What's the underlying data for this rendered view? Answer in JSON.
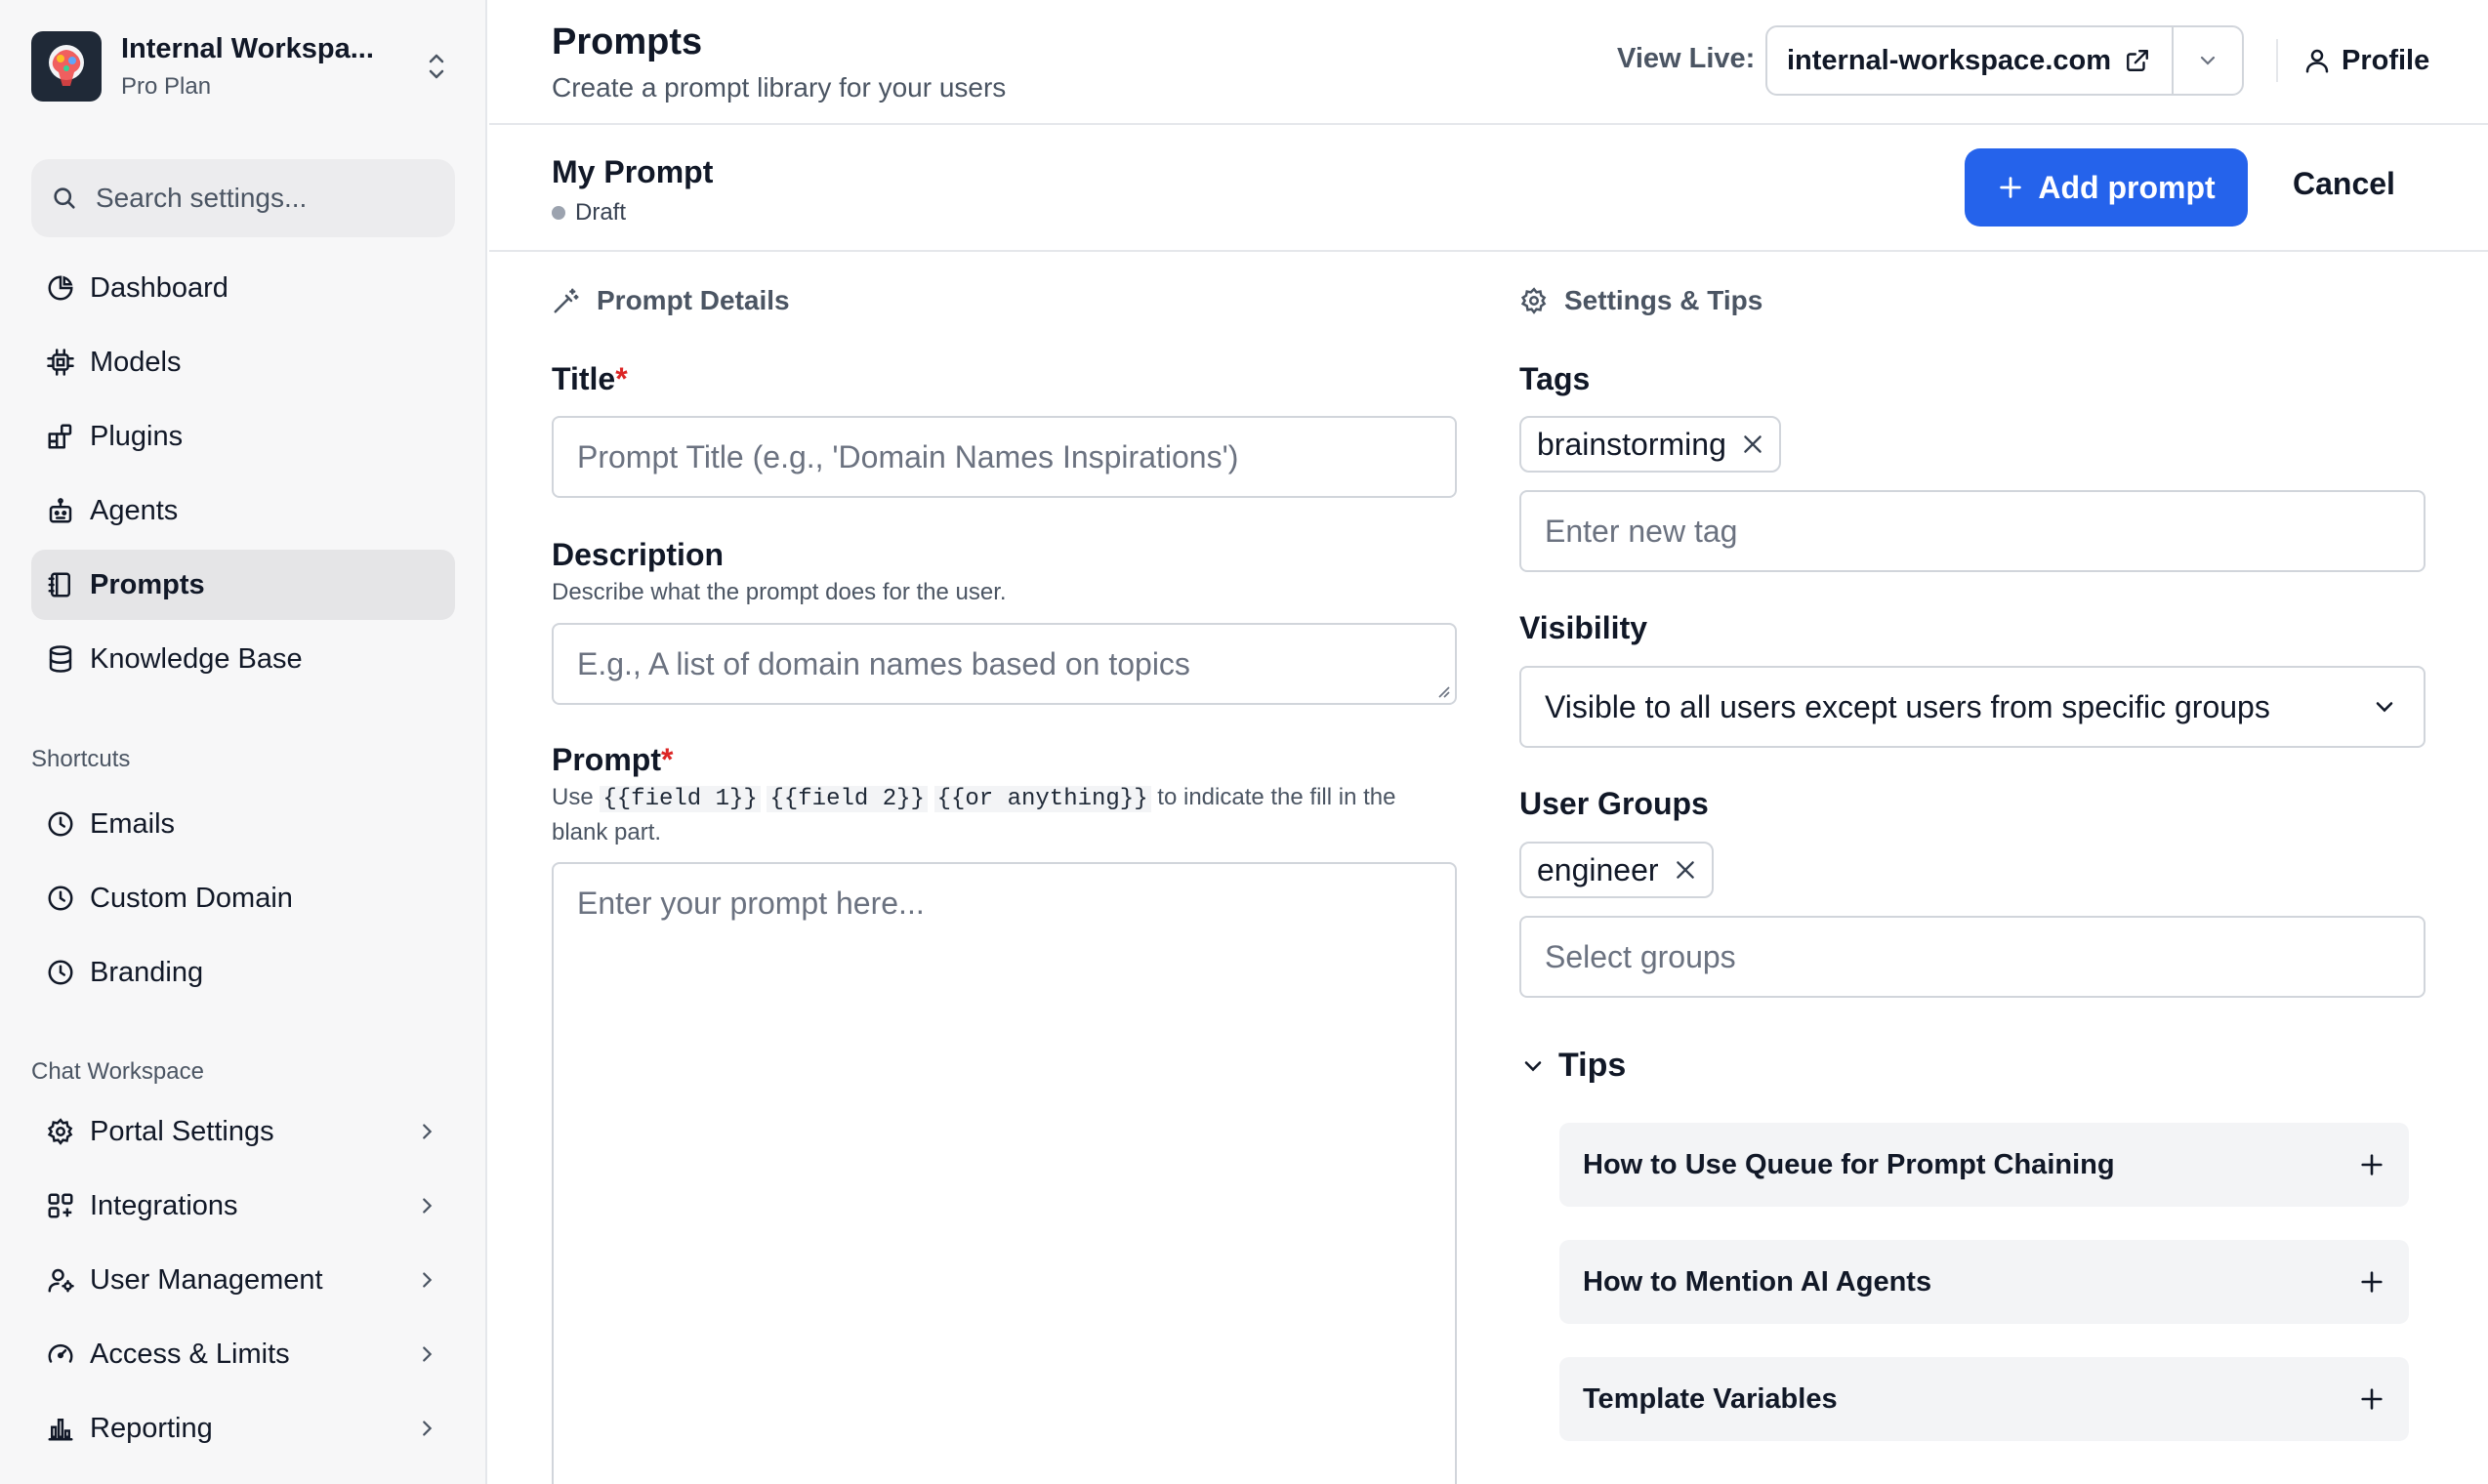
{
  "workspace": {
    "name": "Internal Workspa...",
    "plan": "Pro Plan"
  },
  "search": {
    "placeholder": "Search settings..."
  },
  "nav": {
    "main": [
      {
        "label": "Dashboard",
        "icon": "dashboard-icon"
      },
      {
        "label": "Models",
        "icon": "cpu-icon"
      },
      {
        "label": "Plugins",
        "icon": "plugin-icon"
      },
      {
        "label": "Agents",
        "icon": "bot-icon"
      },
      {
        "label": "Prompts",
        "icon": "notebook-icon",
        "active": true
      },
      {
        "label": "Knowledge Base",
        "icon": "database-icon"
      }
    ],
    "shortcuts_label": "Shortcuts",
    "shortcuts": [
      {
        "label": "Emails",
        "icon": "clock-icon"
      },
      {
        "label": "Custom Domain",
        "icon": "clock-icon"
      },
      {
        "label": "Branding",
        "icon": "clock-icon"
      }
    ],
    "chat_label": "Chat Workspace",
    "chat": [
      {
        "label": "Portal Settings",
        "icon": "gear-icon"
      },
      {
        "label": "Integrations",
        "icon": "grid-icon"
      },
      {
        "label": "User Management",
        "icon": "users-gear-icon"
      },
      {
        "label": "Access & Limits",
        "icon": "gauge-icon"
      },
      {
        "label": "Reporting",
        "icon": "bar-chart-icon"
      }
    ]
  },
  "header": {
    "title": "Prompts",
    "subtitle": "Create a prompt library for your users",
    "view_live_label": "View Live:",
    "domain": "internal-workspace.com",
    "profile_label": "Profile"
  },
  "editor": {
    "prompt_name": "My Prompt",
    "status": "Draft",
    "add_button": "Add prompt",
    "cancel_button": "Cancel"
  },
  "details": {
    "section_title": "Prompt Details",
    "title_label": "Title",
    "title_placeholder": "Prompt Title (e.g., 'Domain Names Inspirations')",
    "description_label": "Description",
    "description_help": "Describe what the prompt does for the user.",
    "description_placeholder": "E.g., A list of domain names based on topics",
    "prompt_label": "Prompt",
    "prompt_help_use": "Use",
    "prompt_help_code1": "{{field 1}}",
    "prompt_help_code2": "{{field 2}}",
    "prompt_help_code3": "{{or anything}}",
    "prompt_help_tail": "to indicate the fill in the blank part.",
    "prompt_placeholder": "Enter your prompt here..."
  },
  "settings": {
    "section_title": "Settings & Tips",
    "tags_label": "Tags",
    "tags": [
      "brainstorming"
    ],
    "tag_placeholder": "Enter new tag",
    "visibility_label": "Visibility",
    "visibility_value": "Visible to all users except users from specific groups",
    "groups_label": "User Groups",
    "groups": [
      "engineer"
    ],
    "groups_placeholder": "Select groups",
    "tips_label": "Tips",
    "tips": [
      "How to Use Queue for Prompt Chaining",
      "How to Mention AI Agents",
      "Template Variables"
    ]
  }
}
